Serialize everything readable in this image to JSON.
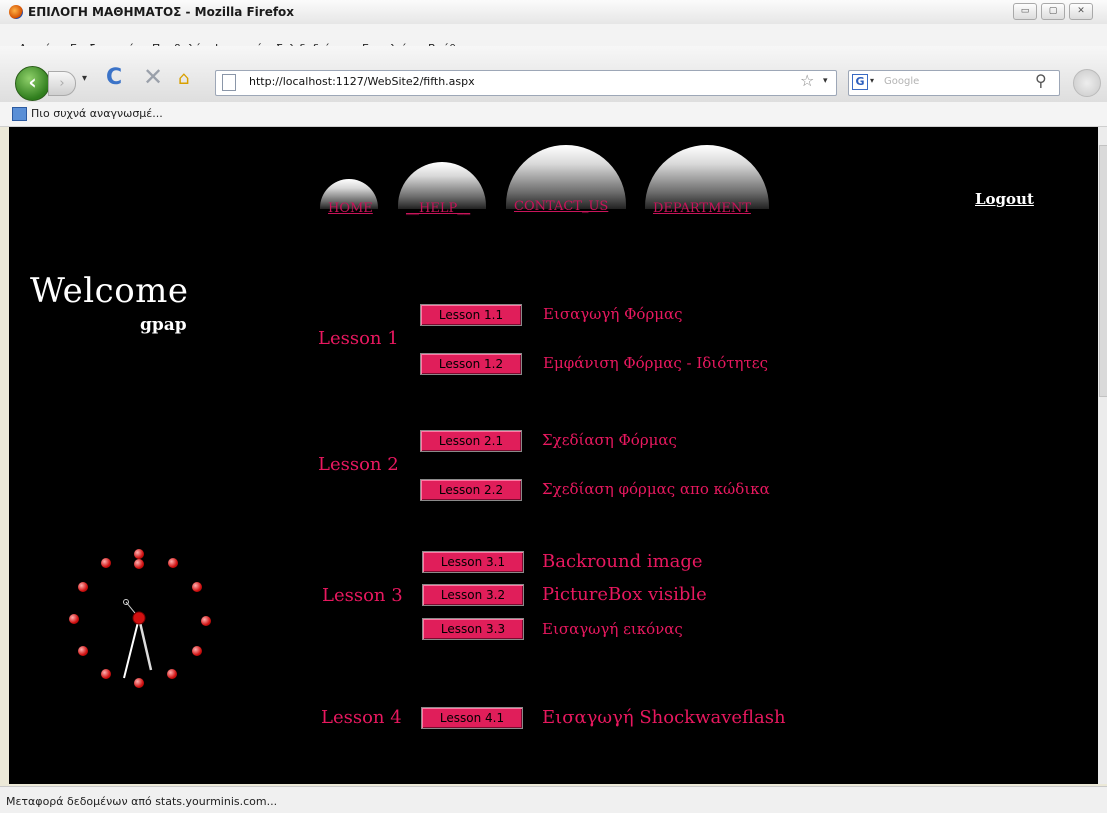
{
  "window": {
    "title": "ΕΠΙΛΟΓΗ ΜΑΘΗΜΑΤΟΣ - Mozilla Firefox",
    "controls": [
      "▭",
      "▢",
      "✕"
    ]
  },
  "menu": [
    "Αρχείο",
    "Επεξεργασία",
    "Προβολή",
    "Ιστορικό",
    "Σελιδοδείκτες",
    "Εργαλεία",
    "Βοήθεια"
  ],
  "navbar": {
    "back_glyph": "‹",
    "forward_glyph": "›",
    "history_dropdown": "▾",
    "reload_glyph": "C",
    "stop_glyph": "✕",
    "home_glyph": "⌂",
    "url": "http://localhost:1127/WebSite2/fifth.aspx",
    "star_glyph": "☆",
    "url_dropdown": "▾",
    "search_engine_glyph": "G",
    "search_dropdown": "▾",
    "search_placeholder": "Google",
    "search_glyph": "⚲"
  },
  "bookmarks": {
    "label": "Πιο συχνά αναγνωσμέ..."
  },
  "status": {
    "text": "Μεταφορά δεδομένων από stats.yourminis.com..."
  },
  "site": {
    "nav": [
      "HOME",
      "__HELP__",
      "CONTACT_US",
      "DEPARTMENT"
    ],
    "logout": "Logout",
    "welcome": "Welcome",
    "username": "gpap",
    "lessons": [
      {
        "label": "Lesson 1",
        "items": [
          {
            "button": "Lesson 1.1",
            "topic": "Εισαγωγή Φόρμας"
          },
          {
            "button": "Lesson 1.2",
            "topic": "Εμφάνιση Φόρμας - Ιδιότητες"
          }
        ]
      },
      {
        "label": "Lesson 2",
        "items": [
          {
            "button": "Lesson 2.1",
            "topic": "Σχεδίαση Φόρμας"
          },
          {
            "button": "Lesson 2.2",
            "topic": "Σχεδίαση φόρμας απο κώδικα"
          }
        ]
      },
      {
        "label": "Lesson 3",
        "items": [
          {
            "button": "Lesson 3.1",
            "topic": "Backround image"
          },
          {
            "button": "Lesson 3.2",
            "topic": "PictureBox visible"
          },
          {
            "button": "Lesson 3.3",
            "topic": "Εισαγωγή εικόνας"
          }
        ]
      },
      {
        "label": "Lesson 4",
        "items": [
          {
            "button": "Lesson 4.1",
            "topic": "Εισαγωγή Shockwaveflash"
          }
        ]
      }
    ]
  },
  "colors": {
    "accent": "#e8185f",
    "button": "#e01e5a",
    "page_background": "#000000"
  }
}
